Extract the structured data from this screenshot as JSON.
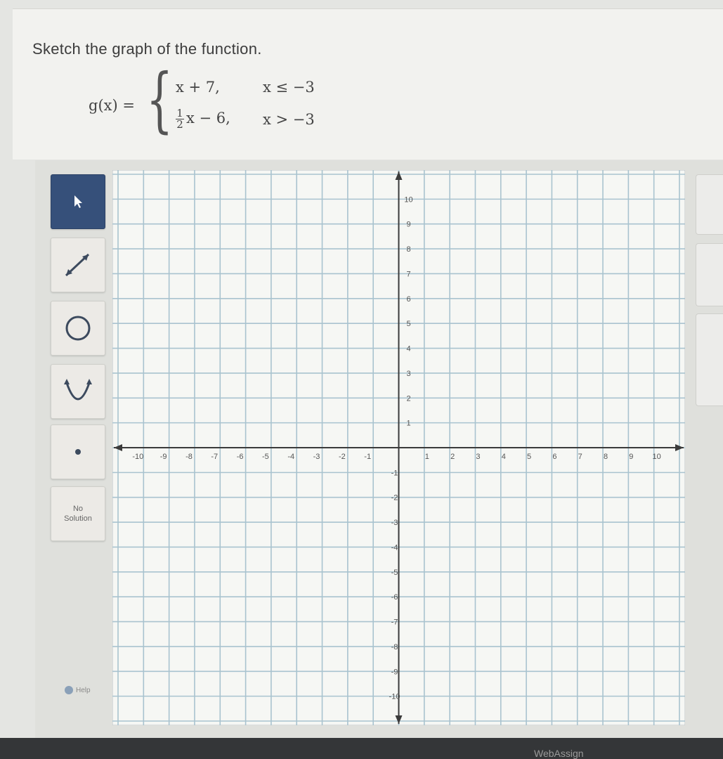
{
  "question": {
    "prompt": "Sketch the graph of the function.",
    "function_name": "g(x) =",
    "pieces": [
      {
        "expr": "x + 7,",
        "condition": "x ≤ −3"
      },
      {
        "coef_num": "1",
        "coef_den": "2",
        "expr": "x − 6,",
        "condition": "x > −3"
      }
    ]
  },
  "tools": [
    {
      "name": "pointer",
      "icon": "cursor-arrow-icon",
      "active": true
    },
    {
      "name": "line",
      "icon": "line-segment-icon"
    },
    {
      "name": "circle",
      "icon": "circle-icon"
    },
    {
      "name": "parabola",
      "icon": "parabola-icon"
    },
    {
      "name": "point",
      "icon": "point-dot-icon"
    },
    {
      "name": "no_solution",
      "label_line1": "No",
      "label_line2": "Solution"
    }
  ],
  "help_label": "Help",
  "graph": {
    "xmin": -10,
    "xmax": 10,
    "ymin": -10,
    "ymax": 10,
    "grid": true,
    "x_ticks": [
      "-10",
      "-9",
      "-8",
      "-7",
      "-6",
      "-5",
      "-4",
      "-3",
      "-2",
      "-1",
      "1",
      "2",
      "3",
      "4",
      "5",
      "6",
      "7",
      "8",
      "9",
      "10"
    ],
    "y_ticks": [
      "10",
      "9",
      "8",
      "7",
      "6",
      "5",
      "4",
      "3",
      "2",
      "1",
      "-1",
      "-2",
      "-3",
      "-4",
      "-5",
      "-6",
      "-7",
      "-8",
      "-9",
      "-10"
    ],
    "grid_color": "#a9c3cf",
    "axis_color": "#3b3b3b"
  },
  "footer": {
    "brand": "WebAssign"
  },
  "colors": {
    "active_tool": "#36507a"
  }
}
